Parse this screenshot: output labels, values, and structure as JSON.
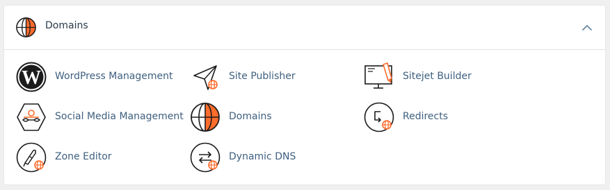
{
  "section": {
    "title": "Domains",
    "header_icon": "globe-icon",
    "collapse_icon": "chevron-up-icon"
  },
  "colors": {
    "accent": "#ff6c2c",
    "link": "#3e5f7f",
    "title": "#293a4a",
    "icon_stroke": "#1b1b1b"
  },
  "items": [
    {
      "label": "WordPress Management",
      "icon": "wordpress-icon"
    },
    {
      "label": "Site Publisher",
      "icon": "site-publisher-icon"
    },
    {
      "label": "Sitejet Builder",
      "icon": "sitejet-builder-icon"
    },
    {
      "label": "Social Media Management",
      "icon": "social-media-icon"
    },
    {
      "label": "Domains",
      "icon": "domains-globe-icon"
    },
    {
      "label": "Redirects",
      "icon": "redirects-icon"
    },
    {
      "label": "Zone Editor",
      "icon": "zone-editor-icon"
    },
    {
      "label": "Dynamic DNS",
      "icon": "dynamic-dns-icon"
    }
  ]
}
